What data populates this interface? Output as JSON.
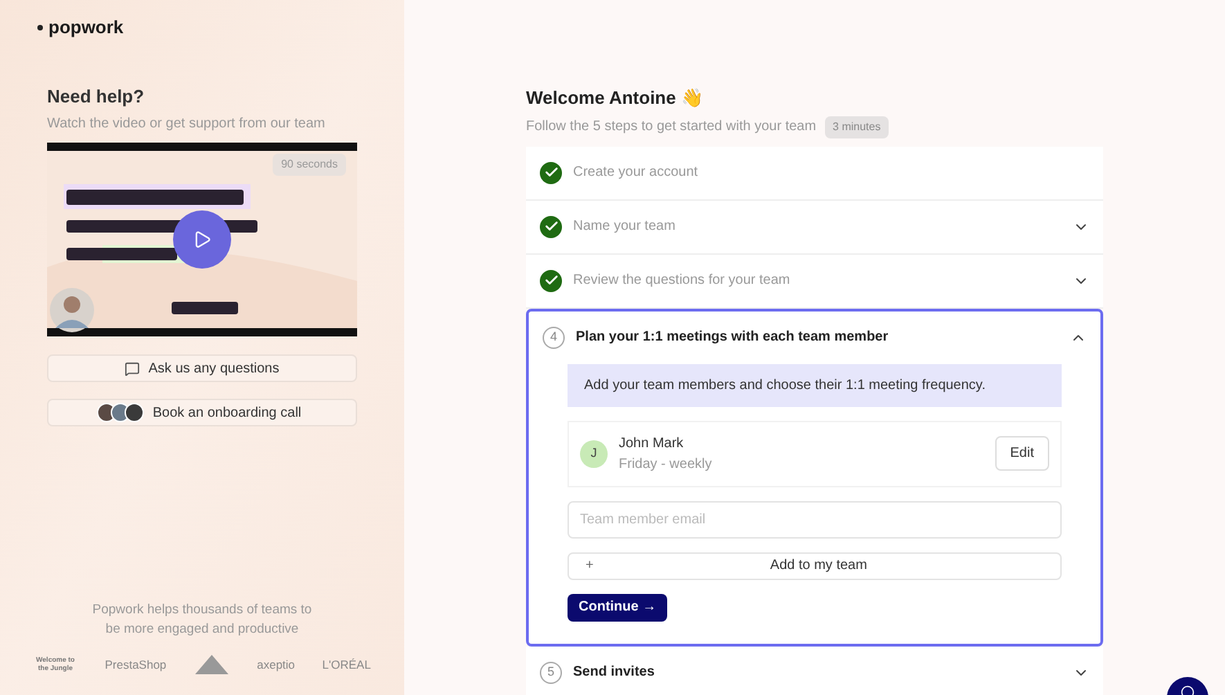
{
  "brand": "popwork",
  "help": {
    "title": "Need help?",
    "subtitle": "Watch the video or get support from our team",
    "video": {
      "duration": "90 seconds"
    },
    "buttons": [
      {
        "kind": "chat",
        "label": "Ask us any questions"
      },
      {
        "kind": "avatars",
        "label": "Book an onboarding call"
      }
    ]
  },
  "social_proof": {
    "text": "Popwork helps thousands of teams to be more engaged and productive",
    "logos": [
      {
        "kind": "wordmark",
        "text": "Welcome to the Jungle"
      },
      {
        "kind": "wordmark",
        "text": "PrestaShop"
      },
      {
        "kind": "emblem"
      },
      {
        "kind": "wordmark",
        "text": "axeptio"
      },
      {
        "kind": "wordmark",
        "text": "L'ORÉAL"
      }
    ]
  },
  "welcome": {
    "title": "Welcome Antoine 👋",
    "subtitle": "Follow the 5 steps to get started with your team",
    "duration": "3 minutes"
  },
  "steps": [
    {
      "label": "Create your account",
      "done": true,
      "expandable": false,
      "expanded": false
    },
    {
      "label": "Name your team",
      "done": true,
      "expandable": true,
      "expanded": false
    },
    {
      "label": "Review the questions for your team",
      "done": true,
      "expandable": true,
      "expanded": false
    },
    {
      "number": "4",
      "label": "Plan your 1:1 meetings with each team member",
      "done": false,
      "expandable": true,
      "expanded": true
    },
    {
      "number": "5",
      "label": "Send invites",
      "done": false,
      "expandable": true,
      "expanded": false
    }
  ],
  "plan": {
    "info": "Add your team members and choose their 1:1 meeting frequency.",
    "members": [
      {
        "initial": "J",
        "name": "John Mark",
        "schedule": "Friday - weekly",
        "action": "Edit"
      }
    ],
    "email_placeholder": "Team member email",
    "add_icon": "+",
    "add_label": "Add to my team",
    "continue": "Continue →"
  }
}
